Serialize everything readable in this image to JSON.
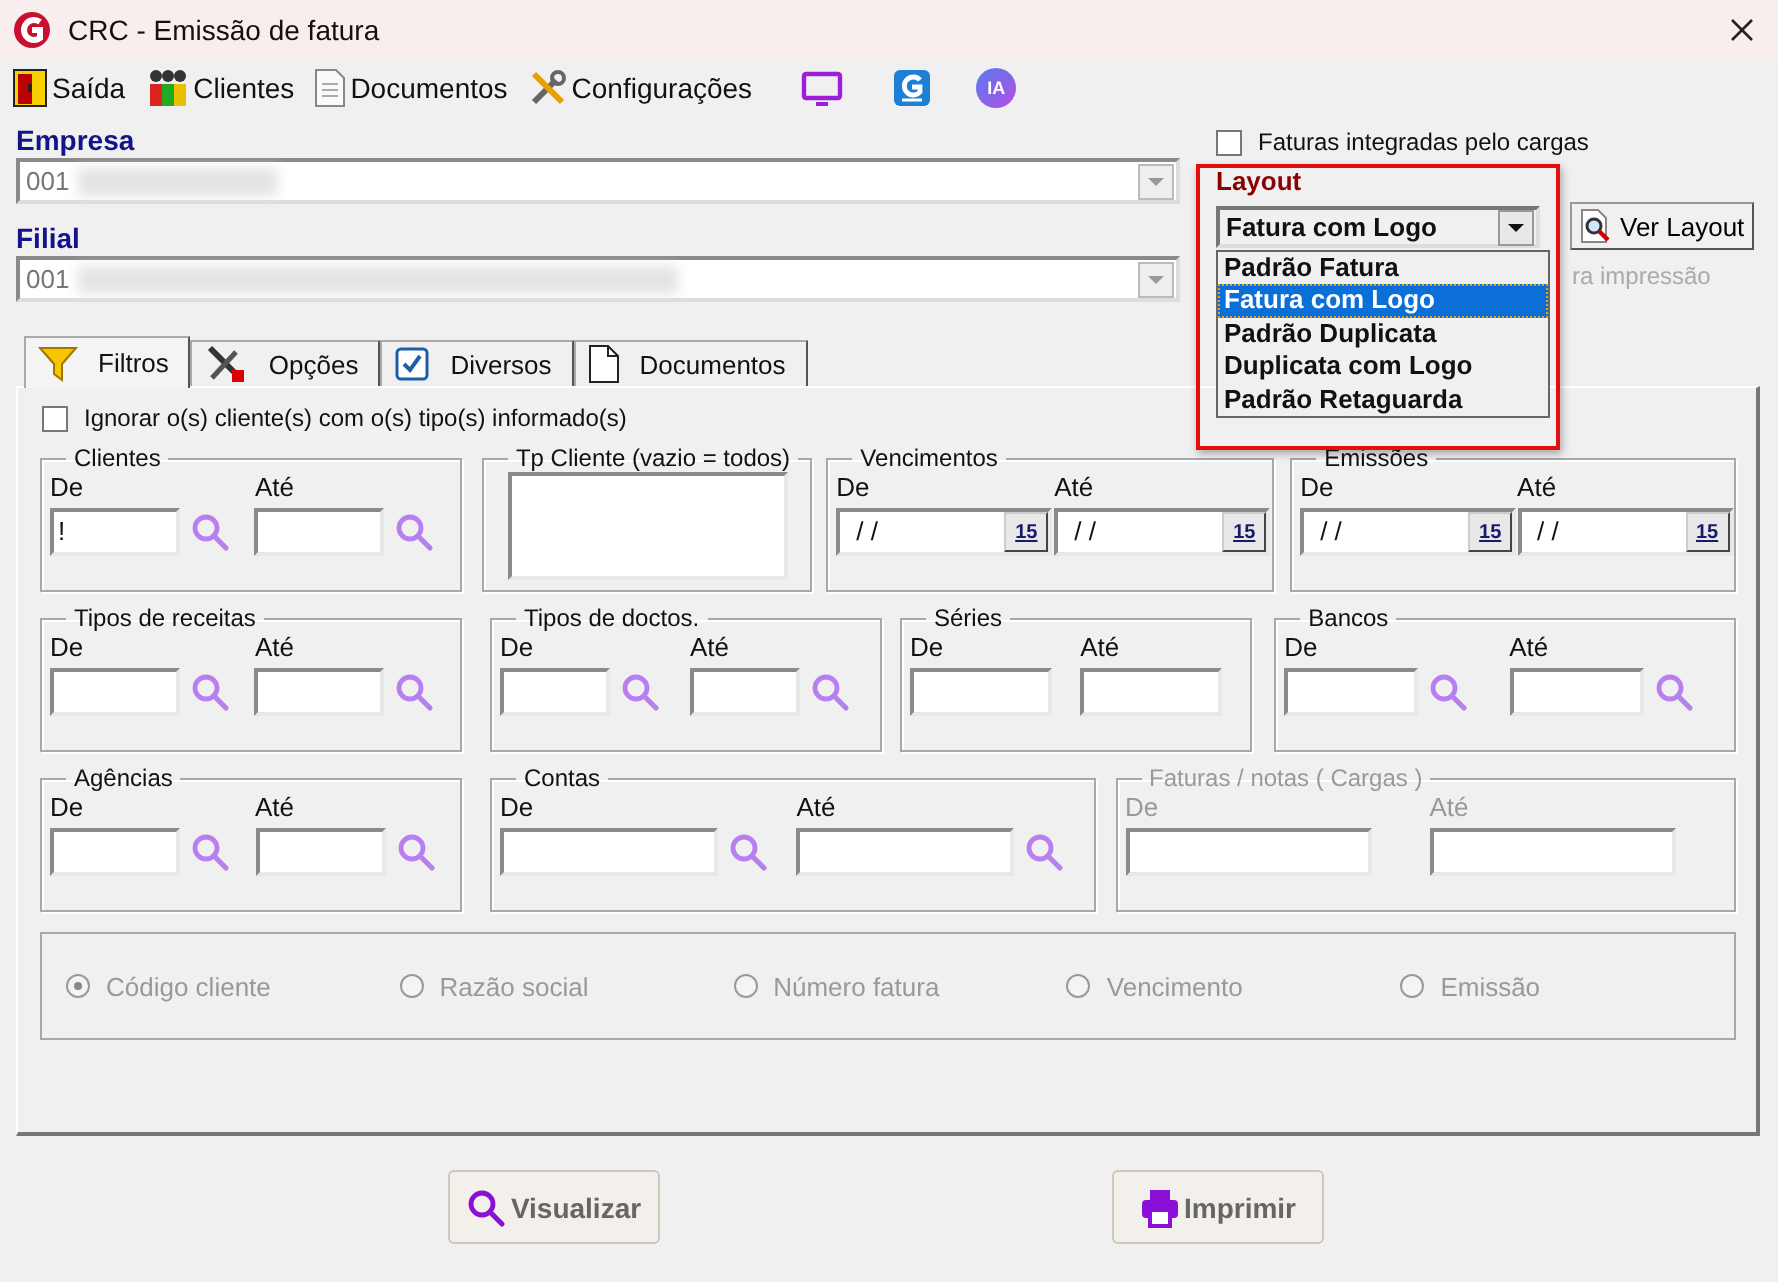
{
  "window": {
    "title": "CRC - Emissão de fatura"
  },
  "toolbar": [
    {
      "kind": "exit",
      "label": "Saída"
    },
    {
      "kind": "clients",
      "label": "Clientes"
    },
    {
      "kind": "documents",
      "label": "Documentos"
    },
    {
      "kind": "settings",
      "label": "Configurações"
    },
    {
      "kind": "monitor"
    },
    {
      "kind": "app"
    },
    {
      "kind": "ai",
      "label": "IA"
    }
  ],
  "empresa": {
    "label": "Empresa",
    "value": "001"
  },
  "filial": {
    "label": "Filial",
    "value": "001"
  },
  "integrated_checkbox": {
    "label": "Faturas integradas pelo cargas",
    "checked": false
  },
  "layout": {
    "label": "Layout",
    "value": "Fatura com Logo",
    "button": "Ver Layout",
    "hidden_note": "ra impressão",
    "options": [
      {
        "label": "Padrão Fatura",
        "selected": false
      },
      {
        "label": "Fatura com Logo",
        "selected": true
      },
      {
        "label": "Padrão Duplicata",
        "selected": false
      },
      {
        "label": "Duplicata com Logo",
        "selected": false
      },
      {
        "label": "Padrão Retaguarda",
        "selected": false
      }
    ]
  },
  "tabs": [
    {
      "kind": "filter",
      "label": "Filtros",
      "selected": true
    },
    {
      "kind": "tools",
      "label": "Opções",
      "selected": false
    },
    {
      "kind": "check",
      "label": "Diversos",
      "selected": false
    },
    {
      "kind": "document",
      "label": "Documentos",
      "selected": false
    }
  ],
  "ignore_checkbox": {
    "label": "Ignorar o(s) cliente(s) com o(s) tipo(s) informado(s)",
    "checked": false
  },
  "groups": [
    [
      {
        "title": "Clientes",
        "disabled": false,
        "fields": [
          {
            "label": "De",
            "kind": "lookup",
            "value": "!"
          },
          {
            "label": "Até",
            "kind": "lookup"
          }
        ]
      },
      {
        "title": "Tp Cliente (vazio = todos)",
        "disabled": false,
        "fields": [
          {
            "kind": "memo"
          }
        ]
      },
      {
        "title": "Vencimentos",
        "disabled": false,
        "fields": [
          {
            "label": "De",
            "kind": "date",
            "value": "/ /",
            "button": "15"
          },
          {
            "label": "Até",
            "kind": "date",
            "value": "/ /",
            "button": "15"
          }
        ]
      },
      {
        "title": "Emissões",
        "disabled": false,
        "fields": [
          {
            "label": "De",
            "kind": "date",
            "value": "/ /",
            "button": "15"
          },
          {
            "label": "Até",
            "kind": "date",
            "value": "/ /",
            "button": "15"
          }
        ]
      }
    ],
    [
      {
        "title": "Tipos de receitas",
        "disabled": false,
        "fields": [
          {
            "label": "De",
            "kind": "lookup"
          },
          {
            "label": "Até",
            "kind": "lookup"
          }
        ]
      },
      {
        "title": "Tipos de doctos.",
        "disabled": false,
        "fields": [
          {
            "label": "De",
            "kind": "lookup"
          },
          {
            "label": "Até",
            "kind": "lookup"
          }
        ]
      },
      {
        "title": "Séries",
        "disabled": false,
        "fields": [
          {
            "label": "De",
            "kind": "plain"
          },
          {
            "label": "Até",
            "kind": "plain"
          }
        ]
      },
      {
        "title": "Bancos",
        "disabled": false,
        "fields": [
          {
            "label": "De",
            "kind": "lookup"
          },
          {
            "label": "Até",
            "kind": "lookup"
          }
        ]
      }
    ],
    [
      {
        "title": "Agências",
        "disabled": false,
        "fields": [
          {
            "label": "De",
            "kind": "lookup"
          },
          {
            "label": "Até",
            "kind": "lookup"
          }
        ]
      },
      {
        "title": "Contas",
        "disabled": false,
        "fields": [
          {
            "label": "De",
            "kind": "lookup"
          },
          {
            "label": "Até",
            "kind": "lookup"
          }
        ]
      },
      {
        "title": "Faturas / notas ( Cargas )",
        "disabled": true,
        "fields": [
          {
            "label": "De",
            "kind": "plain"
          },
          {
            "label": "Até",
            "kind": "plain"
          }
        ]
      }
    ]
  ],
  "sort": {
    "disabled": true,
    "options": [
      {
        "label": "Código cliente",
        "selected": true
      },
      {
        "label": "Razão social",
        "selected": false
      },
      {
        "label": "Número fatura",
        "selected": false
      },
      {
        "label": "Vencimento",
        "selected": false
      },
      {
        "label": "Emissão",
        "selected": false
      }
    ]
  },
  "buttons": [
    {
      "kind": "preview",
      "label": "Visualizar"
    },
    {
      "kind": "print",
      "label": "Imprimir"
    }
  ]
}
